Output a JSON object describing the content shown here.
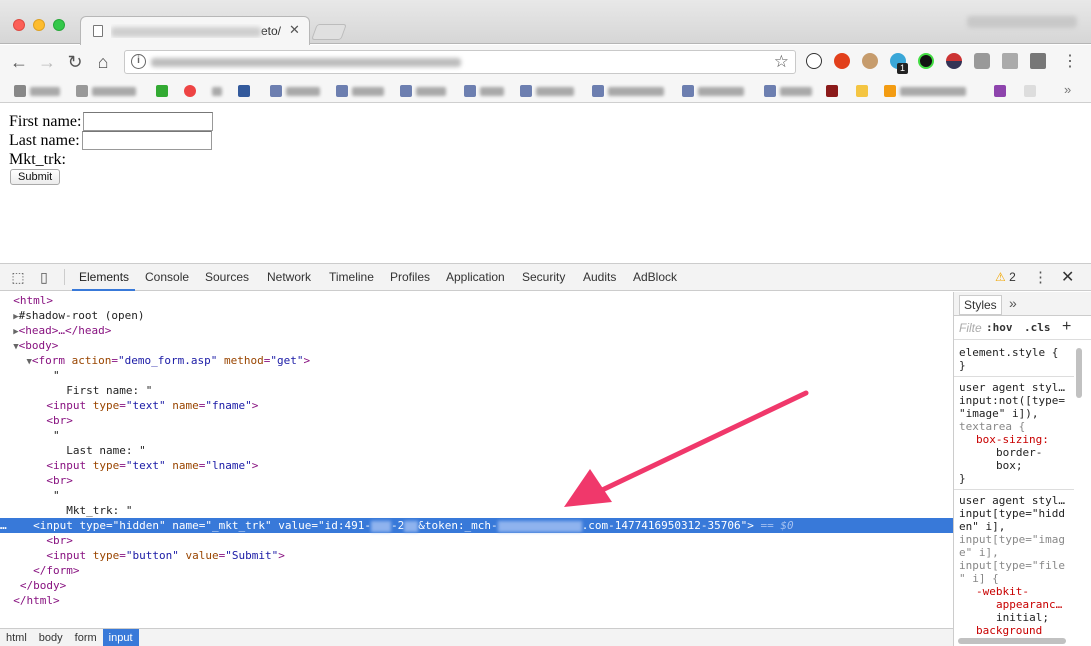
{
  "browser": {
    "tab_title_suffix": "eto/mi",
    "colors": {
      "close": "#fc5f57",
      "minimize": "#fdbc2e",
      "maximize": "#34c84a"
    }
  },
  "toolbar": {
    "back_icon": "back-arrow-icon",
    "forward_icon": "forward-arrow-icon",
    "reload_icon": "reload-icon",
    "home_icon": "home-icon",
    "extension_badge": "1"
  },
  "bookmarks": {
    "items": [
      "Apps",
      "Marketo",
      "",
      "",
      "6",
      "",
      "Ghost",
      "Login",
      "Ideas",
      "SHI",
      "Videos",
      "Whisperer",
      "Threads",
      "Blogs",
      "",
      "",
      "AmazonSmile",
      "",
      ""
    ]
  },
  "page": {
    "first_name_label": "First name:",
    "last_name_label": "Last name:",
    "mkt_trk_label": "Mkt_trk:",
    "submit_label": "Submit"
  },
  "devtools": {
    "tabs": [
      "Elements",
      "Console",
      "Sources",
      "Network",
      "Timeline",
      "Profiles",
      "Application",
      "Security",
      "Audits",
      "AdBlock"
    ],
    "active_tab": "Elements",
    "warning_count": "2",
    "accent": "#3879d9",
    "dom": {
      "html_open": "<html>",
      "shadow_root": "#shadow-root (open)",
      "head": "<head>…</head>",
      "body_open": "<body>",
      "form_tag": "form",
      "form_action_attr": "action",
      "form_action_val": "\"demo_form.asp\"",
      "form_method_attr": "method",
      "form_method_val": "\"get\"",
      "quote": "\"",
      "first_name_text": "  First name: \"",
      "last_name_text": "  Last name: \"",
      "mkt_trk_text": "  Mkt_trk: \"",
      "input_tag": "input",
      "type_attr": "type",
      "name_attr": "name",
      "value_attr": "value",
      "text_val": "\"text\"",
      "fname_val": "\"fname\"",
      "lname_val": "\"lname\"",
      "hidden_val": "\"hidden\"",
      "mkt_name_val": "\"_mkt_trk\"",
      "mkt_value_start": "\"id:491-",
      "mkt_value_mid1": "-2",
      "mkt_value_mid2": "&token:_mch-",
      "mkt_value_end": ".com-1477416950312-35706\"",
      "eq_ref": "== $0",
      "br": "<br>",
      "button_val": "\"button\"",
      "submit_val": "\"Submit\"",
      "form_close": "</form>",
      "body_close": "</body>",
      "html_close": "</html>"
    },
    "breadcrumbs": [
      "html",
      "body",
      "form",
      "input"
    ],
    "active_crumb": "input",
    "styles": {
      "tab_label": "Styles",
      "filter_placeholder": "Filte",
      "hov": ":hov",
      "cls": ".cls",
      "add": "+",
      "element_style": "element.style {",
      "close_brace": "}",
      "ua1": "user agent styl…",
      "ua1_sel1": "input:not([type=",
      "ua1_sel2": "\"image\" i]),",
      "ua1_sel3": "textarea {",
      "box_sizing_prop": "box-sizing:",
      "box_sizing_val1": "border-",
      "box_sizing_val2": "box;",
      "ua2": "user agent styl…",
      "ua2_sel1": "input[type=\"hidd",
      "ua2_sel2": "en\" i],",
      "ua2_sel3": "input[type=\"imag",
      "ua2_sel4": "e\" i],",
      "ua2_sel5": "input[type=\"file",
      "ua2_sel6": "\" i] {",
      "webkit_prop1": "-webkit-",
      "webkit_prop2": "appearanc…",
      "webkit_val": "initial;",
      "background_prop": "background"
    }
  },
  "annotation": {
    "arrow_color": "#f0386b"
  }
}
